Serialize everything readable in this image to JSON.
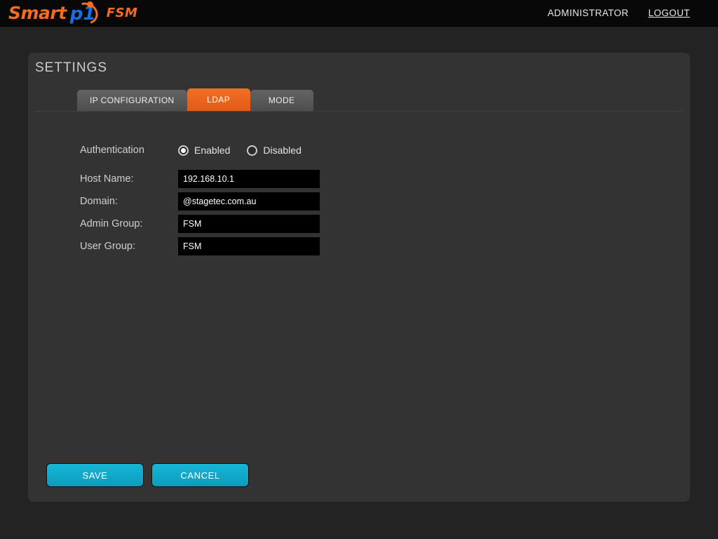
{
  "header": {
    "logo": {
      "smart": "Smart",
      "p1": "p1",
      "fsm": "FSM"
    },
    "user_label": "ADMINISTRATOR",
    "logout_label": "LOGOUT"
  },
  "panel": {
    "title": "SETTINGS",
    "tabs": [
      {
        "label": "IP CONFIGURATION",
        "active": false
      },
      {
        "label": "LDAP",
        "active": true
      },
      {
        "label": "MODE",
        "active": false
      }
    ]
  },
  "form": {
    "auth": {
      "label": "Authentication",
      "options": [
        {
          "label": "Enabled",
          "selected": true
        },
        {
          "label": "Disabled",
          "selected": false
        }
      ]
    },
    "fields": [
      {
        "label": "Host Name:",
        "value": "192.168.10.1",
        "placeholder": ""
      },
      {
        "label": "Domain:",
        "value": "@stagetec.com.au",
        "placeholder": ""
      },
      {
        "label": "Admin Group:",
        "value": "FSM",
        "placeholder": ""
      },
      {
        "label": "User Group:",
        "value": "FSM",
        "placeholder": ""
      }
    ]
  },
  "buttons": {
    "save_label": "SAVE",
    "cancel_label": "CANCEL"
  },
  "colors": {
    "accent_orange": "#ef6f25",
    "accent_cyan": "#17b6d8",
    "logo_blue": "#1a6fe0",
    "page_bg": "#232323",
    "panel_bg": "#333333",
    "header_bg": "#080808"
  }
}
